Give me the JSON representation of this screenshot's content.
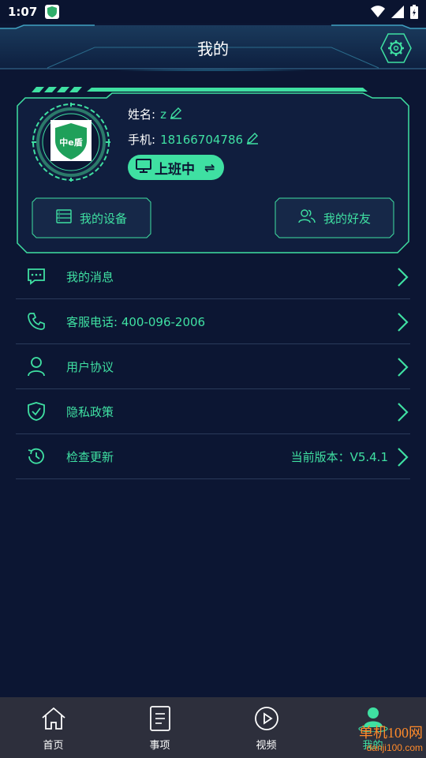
{
  "statusbar": {
    "time": "1:07"
  },
  "header": {
    "title": "我的"
  },
  "profile": {
    "name_label": "姓名:",
    "name_value": "z",
    "phone_label": "手机:",
    "phone_value": "18166704786",
    "status_label": "上班中",
    "status_swap": "⇌",
    "logo_text": "中e盾",
    "buttons": [
      {
        "label": "我的设备"
      },
      {
        "label": "我的好友"
      }
    ]
  },
  "menu": [
    {
      "label": "我的消息",
      "icon": "message-icon"
    },
    {
      "label": "客服电话: 400-096-2006",
      "icon": "phone-icon"
    },
    {
      "label": "用户协议",
      "icon": "user-icon"
    },
    {
      "label": "隐私政策",
      "icon": "shield-check-icon"
    },
    {
      "label": "检查更新",
      "icon": "history-icon",
      "extra": "当前版本：V5.4.1"
    }
  ],
  "nav": [
    {
      "label": "首页",
      "icon": "home-icon"
    },
    {
      "label": "事项",
      "icon": "document-icon"
    },
    {
      "label": "视频",
      "icon": "play-icon"
    },
    {
      "label": "我的",
      "icon": "profile-icon",
      "active": true
    }
  ],
  "watermark": {
    "line1": "单机100网",
    "line2": "danji100.com"
  },
  "colors": {
    "accent": "#3fe0a2",
    "background": "#0c1633",
    "nav_bg": "#2d2f3c"
  }
}
